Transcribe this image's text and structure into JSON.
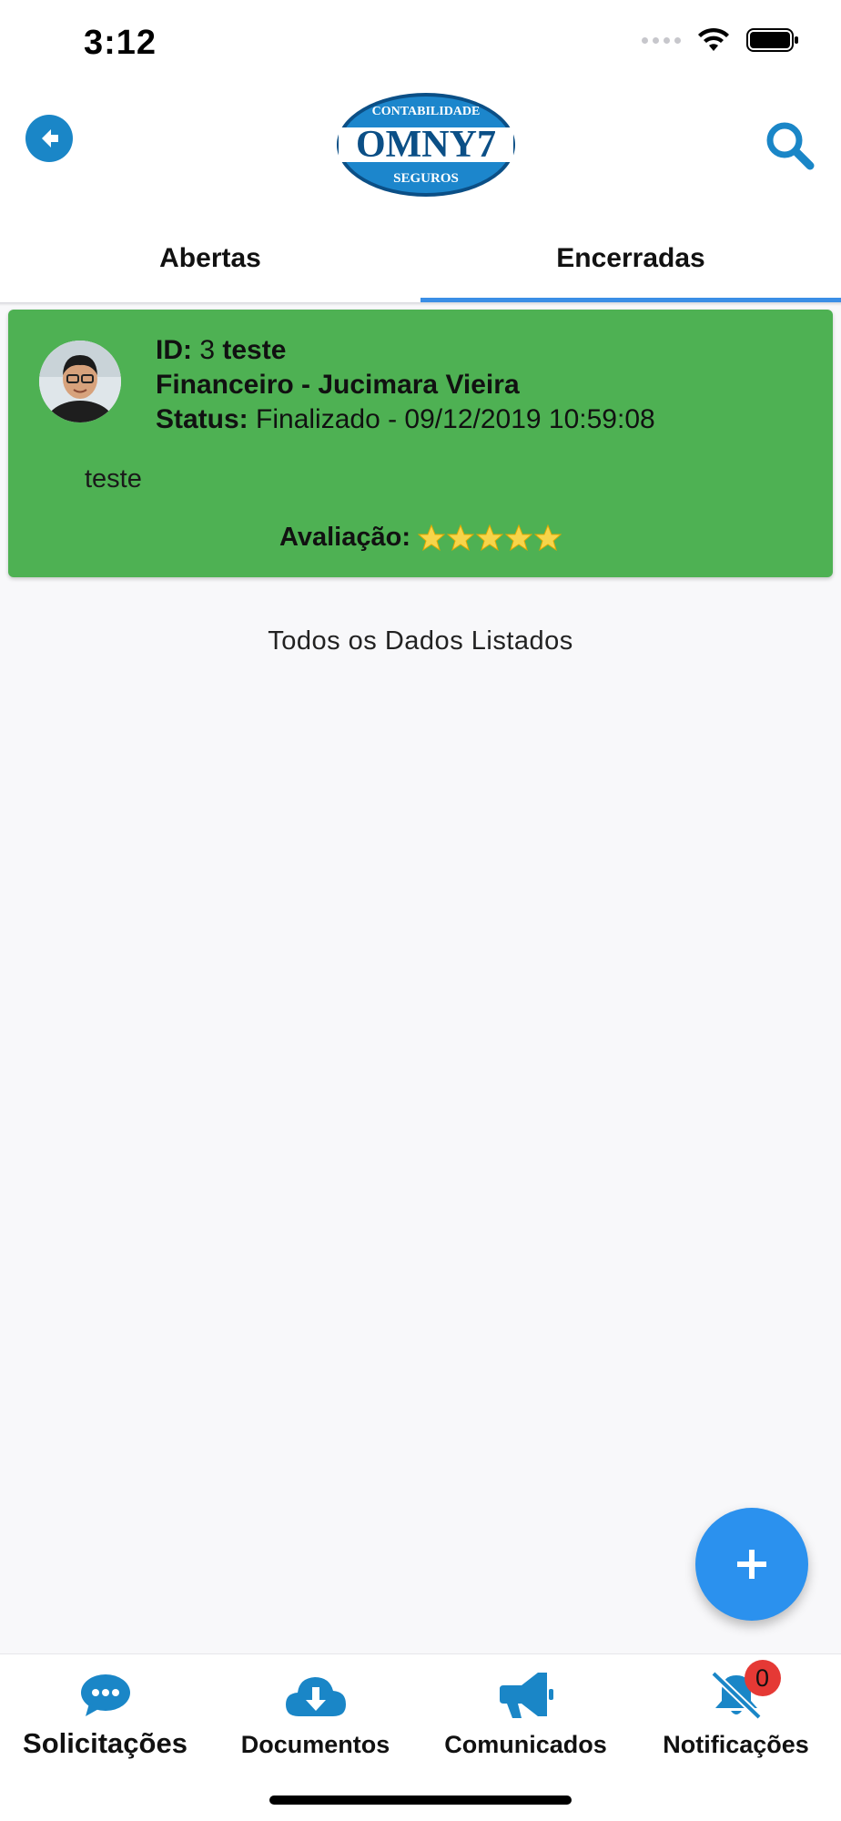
{
  "status_bar": {
    "time": "3:12"
  },
  "header": {
    "logo": {
      "top_text": "CONTABILIDADE",
      "main_text": "OMNY7",
      "bottom_text": "SEGUROS"
    },
    "back_icon": "arrow-left-circle-icon",
    "search_icon": "search-icon"
  },
  "tabs": [
    {
      "label": "Abertas",
      "active": false
    },
    {
      "label": "Encerradas",
      "active": true
    }
  ],
  "ticket": {
    "id_label": "ID:",
    "id_value": "3",
    "title": "teste",
    "department_user": "Financeiro - Jucimara Vieira",
    "status_label": "Status:",
    "status_value": "Finalizado - 09/12/2019 10:59:08",
    "description": "teste",
    "rating_label": "Avaliação:",
    "rating_stars": 5,
    "rating_max": 5,
    "card_color": "#4eb153"
  },
  "list_end_message": "Todos os Dados Listados",
  "fab_icon": "plus-icon",
  "bottom_nav": [
    {
      "label": "Solicitações",
      "icon": "chat-bubble-icon",
      "active": true
    },
    {
      "label": "Documentos",
      "icon": "cloud-download-icon",
      "active": false
    },
    {
      "label": "Comunicados",
      "icon": "megaphone-icon",
      "active": false
    },
    {
      "label": "Notificações",
      "icon": "bell-slash-icon",
      "active": false,
      "badge": "0"
    }
  ],
  "colors": {
    "accent": "#1a86c7",
    "tab_indicator": "#3a8ee6",
    "fab": "#2b91ee",
    "badge": "#e53935"
  }
}
